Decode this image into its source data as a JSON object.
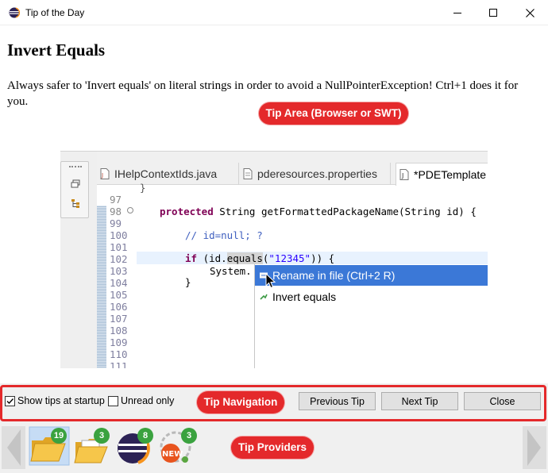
{
  "window": {
    "title": "Tip of the Day"
  },
  "tip": {
    "heading": "Invert Equals",
    "body": "Always safer to 'Invert equals' on literal strings in order to avoid a NullPointerException! Ctrl+1 does it for you."
  },
  "callouts": {
    "tip_area": "Tip Area (Browser or SWT)",
    "tip_navigation": "Tip Navigation",
    "tip_providers": "Tip Providers"
  },
  "editor": {
    "tabs": [
      {
        "label": "IHelpContextIds.java"
      },
      {
        "label": "pderesources.properties"
      },
      {
        "label": "*PDETemplate"
      }
    ],
    "line_numbers": [
      "97",
      "98",
      "99",
      "100",
      "101",
      "102",
      "103",
      "104",
      "105",
      "106",
      "107",
      "108",
      "109",
      "110",
      "111"
    ],
    "code": {
      "line98_kw": "protected",
      "line98_rest": " String getFormattedPackageName(String id) {",
      "line100_comment": "// id=null; ?",
      "line102_kw": "if",
      "line102_a": " (id.",
      "line102_method": "equals",
      "line102_b": "(",
      "line102_string": "\"12345\"",
      "line102_c": ")) {",
      "line103": "System.",
      "line104": "}"
    },
    "quickfix": {
      "items": [
        {
          "label": "Rename in file (Ctrl+2 R)"
        },
        {
          "label": "Invert equals"
        }
      ]
    }
  },
  "navigation": {
    "show_tips_label": "Show tips at startup",
    "show_tips_checked": true,
    "unread_only_label": "Unread only",
    "unread_only_checked": false,
    "previous_label": "Previous Tip",
    "next_label": "Next Tip",
    "close_label": "Close"
  },
  "providers": [
    {
      "icon": "folder-icon",
      "count": "19",
      "selected": true
    },
    {
      "icon": "open-folder-icon",
      "count": "3"
    },
    {
      "icon": "eclipse-icon",
      "count": "8"
    },
    {
      "icon": "new-badge-icon",
      "count": "3"
    }
  ],
  "colors": {
    "callout": "#e4292b",
    "badge": "#3aa23f",
    "selection": "#3b78d7"
  }
}
